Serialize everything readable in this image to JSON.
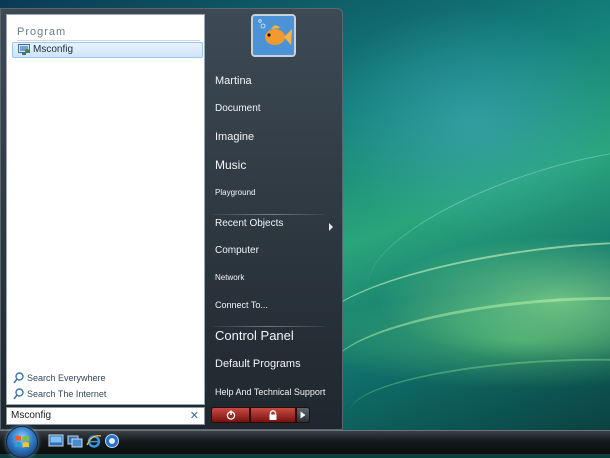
{
  "start_menu": {
    "search_results": {
      "group_header": "Program",
      "items": [
        {
          "label": "Msconfig",
          "icon": "msconfig-icon"
        }
      ]
    },
    "search_links": [
      {
        "label": "Search Everywhere",
        "icon": "search-icon"
      },
      {
        "label": "Search The Internet",
        "icon": "search-icon"
      }
    ],
    "search_box": {
      "value": "Msconfig",
      "clear_icon": "close-icon"
    },
    "user_picture": {
      "icon": "goldfish-avatar-icon"
    },
    "right_items": [
      {
        "label": "Martina"
      },
      {
        "label": "Document"
      },
      {
        "label": "Imagine"
      },
      {
        "label": "Music"
      },
      {
        "label": "Playground"
      },
      {
        "label": "Recent Objects",
        "has_submenu": true
      },
      {
        "label": "Computer"
      },
      {
        "label": "Network"
      },
      {
        "label": "Connect To..."
      },
      {
        "label": "Control Panel"
      },
      {
        "label": "Default Programs"
      },
      {
        "label": "Help And Technical Support"
      }
    ],
    "power_buttons": [
      {
        "name": "power",
        "icon": "power-icon"
      },
      {
        "name": "lock",
        "icon": "lock-icon"
      },
      {
        "name": "more-options",
        "icon": "arrow-right-icon"
      }
    ]
  },
  "taskbar": {
    "start_orb_icon": "windows-logo-icon",
    "quick_launch": [
      {
        "icon": "show-desktop-icon"
      },
      {
        "icon": "switch-windows-icon"
      },
      {
        "icon": "internet-explorer-icon"
      },
      {
        "icon": "media-player-icon"
      }
    ]
  },
  "colors": {
    "power_red": "#b3342c",
    "selection_blue": "#cfe5fa",
    "menu_dark": "#1f272e"
  }
}
